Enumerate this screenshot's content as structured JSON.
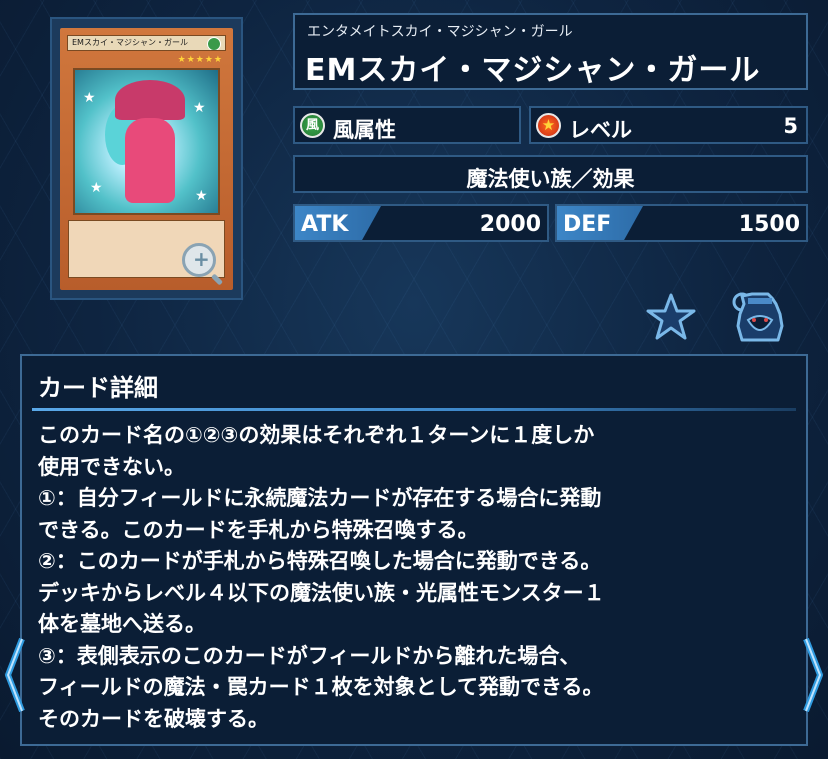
{
  "card": {
    "image_name": "EMスカイ・マジシャン・ガール",
    "furigana": "エンタメイトスカイ・マジシャン・ガール",
    "name": "EMスカイ・マジシャン・ガール",
    "attribute": "風属性",
    "attribute_glyph": "風",
    "level_label": "レベル",
    "level_value": "5",
    "type_line": "魔法使い族／効果",
    "atk_label": "ATK",
    "atk_value": "2000",
    "def_label": "DEF",
    "def_value": "1500"
  },
  "detail": {
    "heading": "カード詳細",
    "text": "このカード名の①②③の効果はそれぞれ１ターンに１度しか\n使用できない。\n①：自分フィールドに永続魔法カードが存在する場合に発動\nできる。このカードを手札から特殊召喚する。\n②：このカードが手札から特殊召喚した場合に発動できる。\nデッキからレベル４以下の魔法使い族・光属性モンスター１\n体を墓地へ送る。\n③：表側表示のこのカードがフィールドから離れた場合、\nフィールドの魔法・罠カード１枚を対象として発動できる。\nそのカードを破壊する。"
  },
  "icons": {
    "zoom": "zoom-in-icon",
    "favorite": "star-icon",
    "deck": "deck-pot-icon",
    "prev": "chevron-left-icon",
    "next": "chevron-right-icon"
  },
  "colors": {
    "accent": "#3d86c7",
    "panel_bg": "#0b1e36",
    "border": "#3d6a95",
    "arrow": "#2f9be0"
  }
}
